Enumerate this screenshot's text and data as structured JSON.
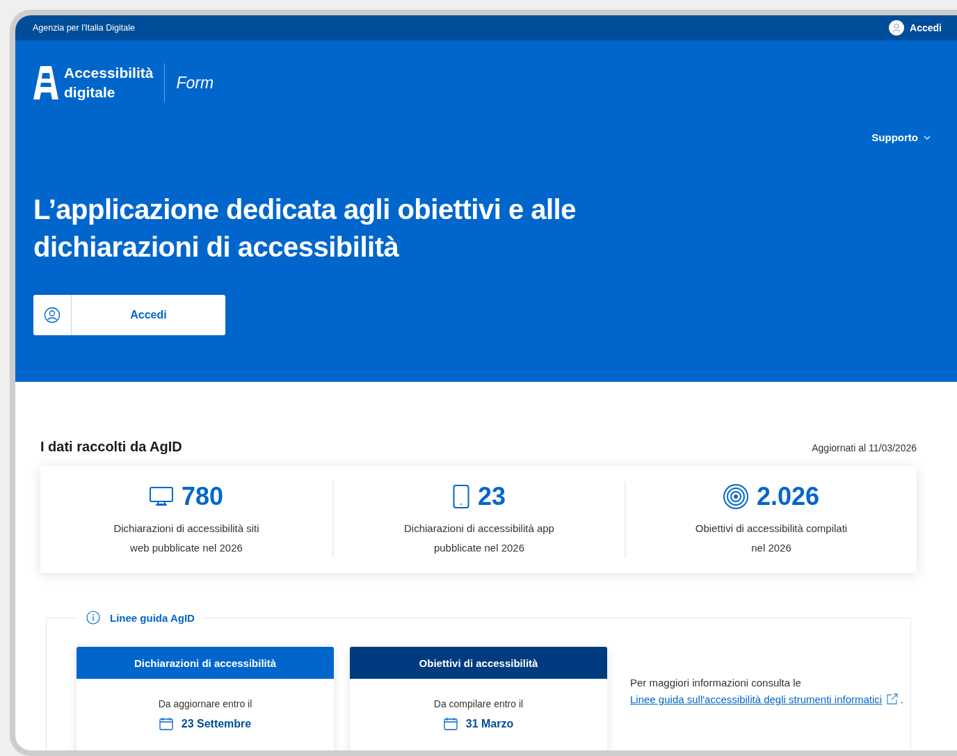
{
  "topbar": {
    "agency": "Agenzia per l'Italia Digitale",
    "login": "Accedi"
  },
  "header": {
    "brand_line1": "Accessibilità",
    "brand_line2": "digitale",
    "product": "Form",
    "nav": [
      {
        "label": "Supporto"
      }
    ]
  },
  "hero": {
    "title": "L’applicazione dedicata agli obiettivi e alle dichiarazioni di accessibilità",
    "button": "Accedi"
  },
  "stats": {
    "title": "I dati raccolti da AgID",
    "updated": "Aggiornati al 11/03/2026",
    "items": [
      {
        "kind": "desktop",
        "value": "780",
        "label": "Dichiarazioni di accessibilità siti web pubblicate nel 2026"
      },
      {
        "kind": "phone",
        "value": "23",
        "label": "Dichiarazioni di accessibilità app pubblicate nel 2026"
      },
      {
        "kind": "target",
        "value": "2.026",
        "label": "Obiettivi di accessibilità compilati nel 2026"
      }
    ]
  },
  "guidelines": {
    "legend": "Linee guida AgID",
    "cards": [
      {
        "title": "Dichiarazioni di accessibilità",
        "color": "#0066cc",
        "caption": "Da aggiornare entro il",
        "date": "23 Settembre"
      },
      {
        "title": "Obiettivi di accessibilità",
        "color": "#003b80",
        "caption": "Da compilare entro il",
        "date": "31 Marzo"
      }
    ],
    "info": {
      "text": "Per maggiori informazioni consulta le",
      "link": "Linee guida sull'accessibilità degli strumenti informatici",
      "suffix": "."
    }
  }
}
